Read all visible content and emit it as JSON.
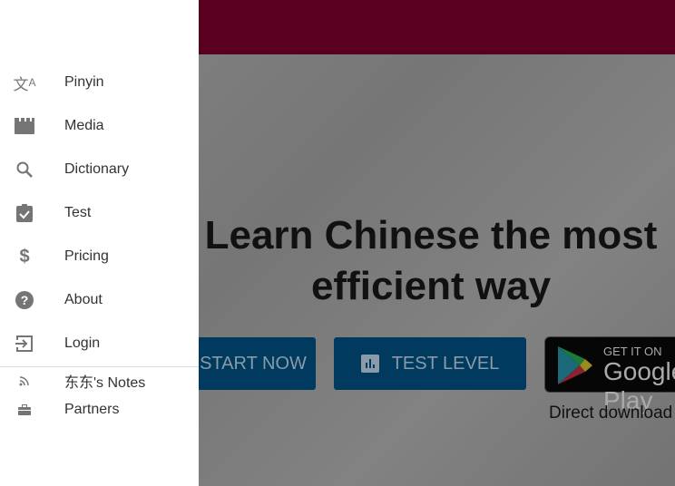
{
  "hero": {
    "title_line1": "Learn Chinese the most",
    "title_line2": "efficient way",
    "start_label": "START NOW",
    "test_label": "TEST LEVEL",
    "play_small": "GET IT ON",
    "play_big": "Google Play",
    "direct_download": "Direct download"
  },
  "drawer": {
    "items": [
      {
        "label": "Pinyin",
        "icon": "translate-icon"
      },
      {
        "label": "Media",
        "icon": "movie-icon"
      },
      {
        "label": "Dictionary",
        "icon": "search-icon"
      },
      {
        "label": "Test",
        "icon": "assignment-check-icon"
      },
      {
        "label": "Pricing",
        "icon": "dollar-icon"
      },
      {
        "label": "About",
        "icon": "help-icon"
      },
      {
        "label": "Login",
        "icon": "login-icon"
      }
    ],
    "secondary": [
      {
        "label": "东东's Notes",
        "icon": "rss-icon"
      },
      {
        "label": "Partners",
        "icon": "briefcase-icon"
      }
    ]
  },
  "colors": {
    "header": "#590021",
    "button": "#003a5e",
    "drawer": "#ffffff"
  }
}
